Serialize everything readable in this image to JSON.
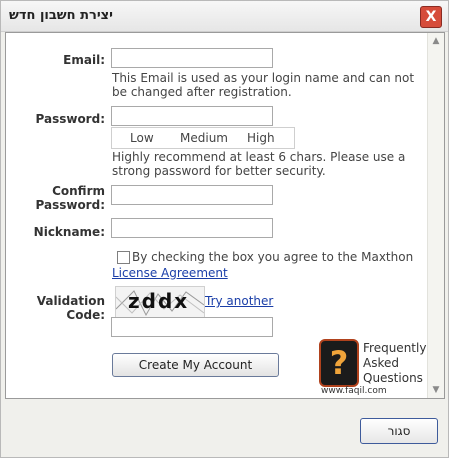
{
  "window": {
    "title": "יצירת חשבון חדש",
    "close_label": "X"
  },
  "form": {
    "email_label": "Email:",
    "email_note": "This Email is used as your login name and can not be changed after registration.",
    "password_label": "Password:",
    "strength": {
      "low": "Low",
      "medium": "Medium",
      "high": "High"
    },
    "password_note": "Highly recommend at least 6 chars. Please use a strong password for better security.",
    "confirm_label_1": "Confirm",
    "confirm_label_2": "Password:",
    "nickname_label": "Nickname:",
    "agreement_text": "By checking the box you agree to the Maxthon",
    "agreement_link": "License Agreement",
    "validation_label_1": "Validation",
    "validation_label_2": "Code:",
    "captcha_text": "zddx",
    "try_another": "Try another",
    "create_button": "Create My Account"
  },
  "faq": {
    "mark": "?",
    "line1": "Frequently",
    "line2": "Asked",
    "line3": "Questions",
    "url": "www.faqil.com"
  },
  "footer": {
    "button": "סגור"
  }
}
